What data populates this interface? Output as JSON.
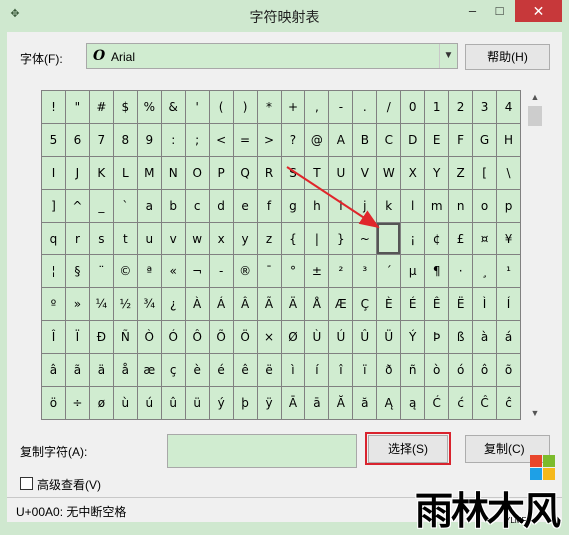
{
  "window": {
    "title": "字符映射表",
    "icon": "charmap-app-icon",
    "controls": {
      "minimize": "–",
      "maximize": "□",
      "close": "✕"
    }
  },
  "font": {
    "label": "字体(F):",
    "value": "Arial",
    "icon_glyph": "O",
    "help_button": "帮助(H)"
  },
  "grid": {
    "rows": [
      [
        "!",
        "\"",
        "#",
        "$",
        "%",
        "&",
        "'",
        "(",
        ")",
        "*",
        "+",
        ",",
        "-",
        ".",
        "/",
        "0",
        "1",
        "2",
        "3",
        "4"
      ],
      [
        "5",
        "6",
        "7",
        "8",
        "9",
        ":",
        ";",
        "<",
        "=",
        ">",
        "?",
        "@",
        "A",
        "B",
        "C",
        "D",
        "E",
        "F",
        "G",
        "H"
      ],
      [
        "I",
        "J",
        "K",
        "L",
        "M",
        "N",
        "O",
        "P",
        "Q",
        "R",
        "S",
        "T",
        "U",
        "V",
        "W",
        "X",
        "Y",
        "Z",
        "[",
        "\\"
      ],
      [
        "]",
        "^",
        "_",
        "`",
        "a",
        "b",
        "c",
        "d",
        "e",
        "f",
        "g",
        "h",
        "i",
        "j",
        "k",
        "l",
        "m",
        "n",
        "o",
        "p"
      ],
      [
        "q",
        "r",
        "s",
        "t",
        "u",
        "v",
        "w",
        "x",
        "y",
        "z",
        "{",
        "|",
        "}",
        "~",
        "",
        "¡",
        "¢",
        "£",
        "¤",
        "¥"
      ],
      [
        "¦",
        "§",
        "¨",
        "©",
        "ª",
        "«",
        "¬",
        "-",
        "®",
        "¯",
        "°",
        "±",
        "²",
        "³",
        "´",
        "µ",
        "¶",
        "·",
        "¸",
        "¹"
      ],
      [
        "º",
        "»",
        "¼",
        "½",
        "¾",
        "¿",
        "À",
        "Á",
        "Â",
        "Ã",
        "Ä",
        "Å",
        "Æ",
        "Ç",
        "È",
        "É",
        "Ê",
        "Ë",
        "Ì",
        "Í"
      ],
      [
        "Î",
        "Ï",
        "Ð",
        "Ñ",
        "Ò",
        "Ó",
        "Ô",
        "Õ",
        "Ö",
        "×",
        "Ø",
        "Ù",
        "Ú",
        "Û",
        "Ü",
        "Ý",
        "Þ",
        "ß",
        "à",
        "á"
      ],
      [
        "â",
        "ã",
        "ä",
        "å",
        "æ",
        "ç",
        "è",
        "é",
        "ê",
        "ë",
        "ì",
        "í",
        "î",
        "ï",
        "ð",
        "ñ",
        "ò",
        "ó",
        "ô",
        "õ"
      ],
      [
        "ö",
        "÷",
        "ø",
        "ù",
        "ú",
        "û",
        "ü",
        "ý",
        "þ",
        "ÿ",
        "Ā",
        "ā",
        "Ă",
        "ă",
        "Ą",
        "ą",
        "Ć",
        "ć",
        "Ĉ",
        "ĉ"
      ]
    ],
    "selected": {
      "row": 4,
      "col": 14
    }
  },
  "copy": {
    "label": "复制字符(A):",
    "value": "",
    "select_button": "选择(S)",
    "copy_button": "复制(C)"
  },
  "advanced": {
    "label": "高级查看(V)",
    "checked": false
  },
  "status": {
    "text": "U+00A0: 无中断空格"
  },
  "watermark": {
    "text": "雨林木风",
    "sub": "YLMF"
  },
  "colors": {
    "background": "#cfe8cf",
    "cell_fill": "#d0ecd0",
    "highlight_border": "#d9232e",
    "annotation_arrow": "#e0262b",
    "close_button": "#c7383a"
  }
}
